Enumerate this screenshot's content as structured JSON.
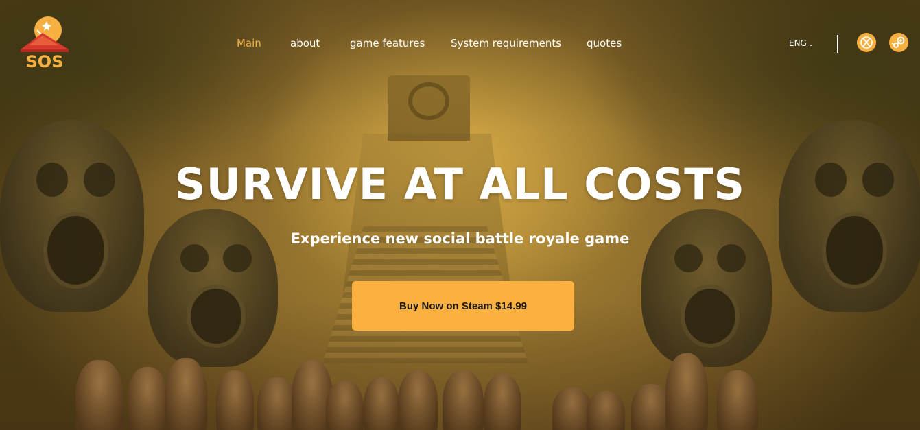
{
  "brand": {
    "logo_text": "SOS",
    "accent_color": "#f5b041",
    "logo_red": "#d63a2c"
  },
  "nav": {
    "items": [
      {
        "label": "Main",
        "active": true
      },
      {
        "label": "about",
        "active": false
      },
      {
        "label": "game features",
        "active": false
      },
      {
        "label": "System requirements",
        "active": false
      },
      {
        "label": "quotes",
        "active": false
      }
    ]
  },
  "language": {
    "selected": "ENG",
    "icon": "chevron-down-icon"
  },
  "platforms": [
    {
      "name": "xbox",
      "icon": "xbox-icon"
    },
    {
      "name": "steam",
      "icon": "steam-icon"
    }
  ],
  "hero": {
    "headline": "SURVIVE AT ALL COSTS",
    "subheadline": "Experience new social battle royale game",
    "cta_label": "Buy Now on Steam $14.99",
    "cta_color": "#fbb040"
  }
}
